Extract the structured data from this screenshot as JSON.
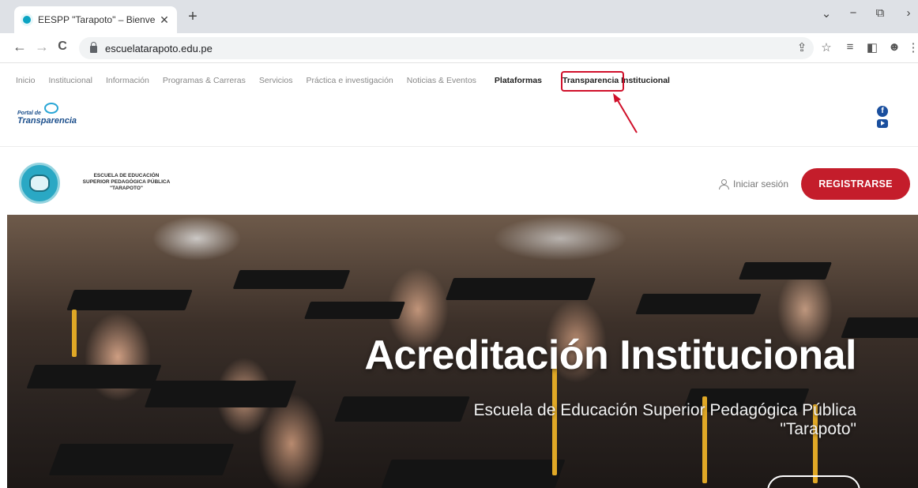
{
  "browser": {
    "tab_title": "EESPP \"Tarapoto\" – Bienvenido, …",
    "tab_close": "✕",
    "new_tab": "+",
    "url": "escuelatarapoto.edu.pe",
    "back": "←",
    "forward": "→",
    "reload": "C",
    "minimize": "−",
    "restore": "⧉",
    "chevron": "⌄"
  },
  "site_nav": {
    "items": [
      {
        "label": "Inicio"
      },
      {
        "label": "Institucional"
      },
      {
        "label": "Información"
      },
      {
        "label": "Programas & Carreras"
      },
      {
        "label": "Servicios"
      },
      {
        "label": "Práctica e investigación"
      },
      {
        "label": "Noticias & Eventos"
      },
      {
        "label": "Plataformas"
      },
      {
        "label": "Transparencia Institucional"
      }
    ],
    "portal": {
      "line1": "Portal de",
      "line2": "Transparencia"
    },
    "social_fb": "f"
  },
  "header": {
    "school_name_1": "ESCUELA DE EDUCACIÓN",
    "school_name_2": "SUPERIOR PEDAGÓGICA PÚBLICA",
    "school_name_3": "\"TARAPOTO\"",
    "login": "Iniciar sesión",
    "register": "REGISTRARSE"
  },
  "hero": {
    "title": "Acreditación Institucional",
    "subtitle_1": "Escuela de Educación Superior Pedagógica Pública",
    "subtitle_2": "\"Tarapoto\""
  },
  "colors": {
    "accent_red": "#c41d2b",
    "nav_highlight": "#d0102a",
    "brand_blue": "#1a4f9e"
  }
}
